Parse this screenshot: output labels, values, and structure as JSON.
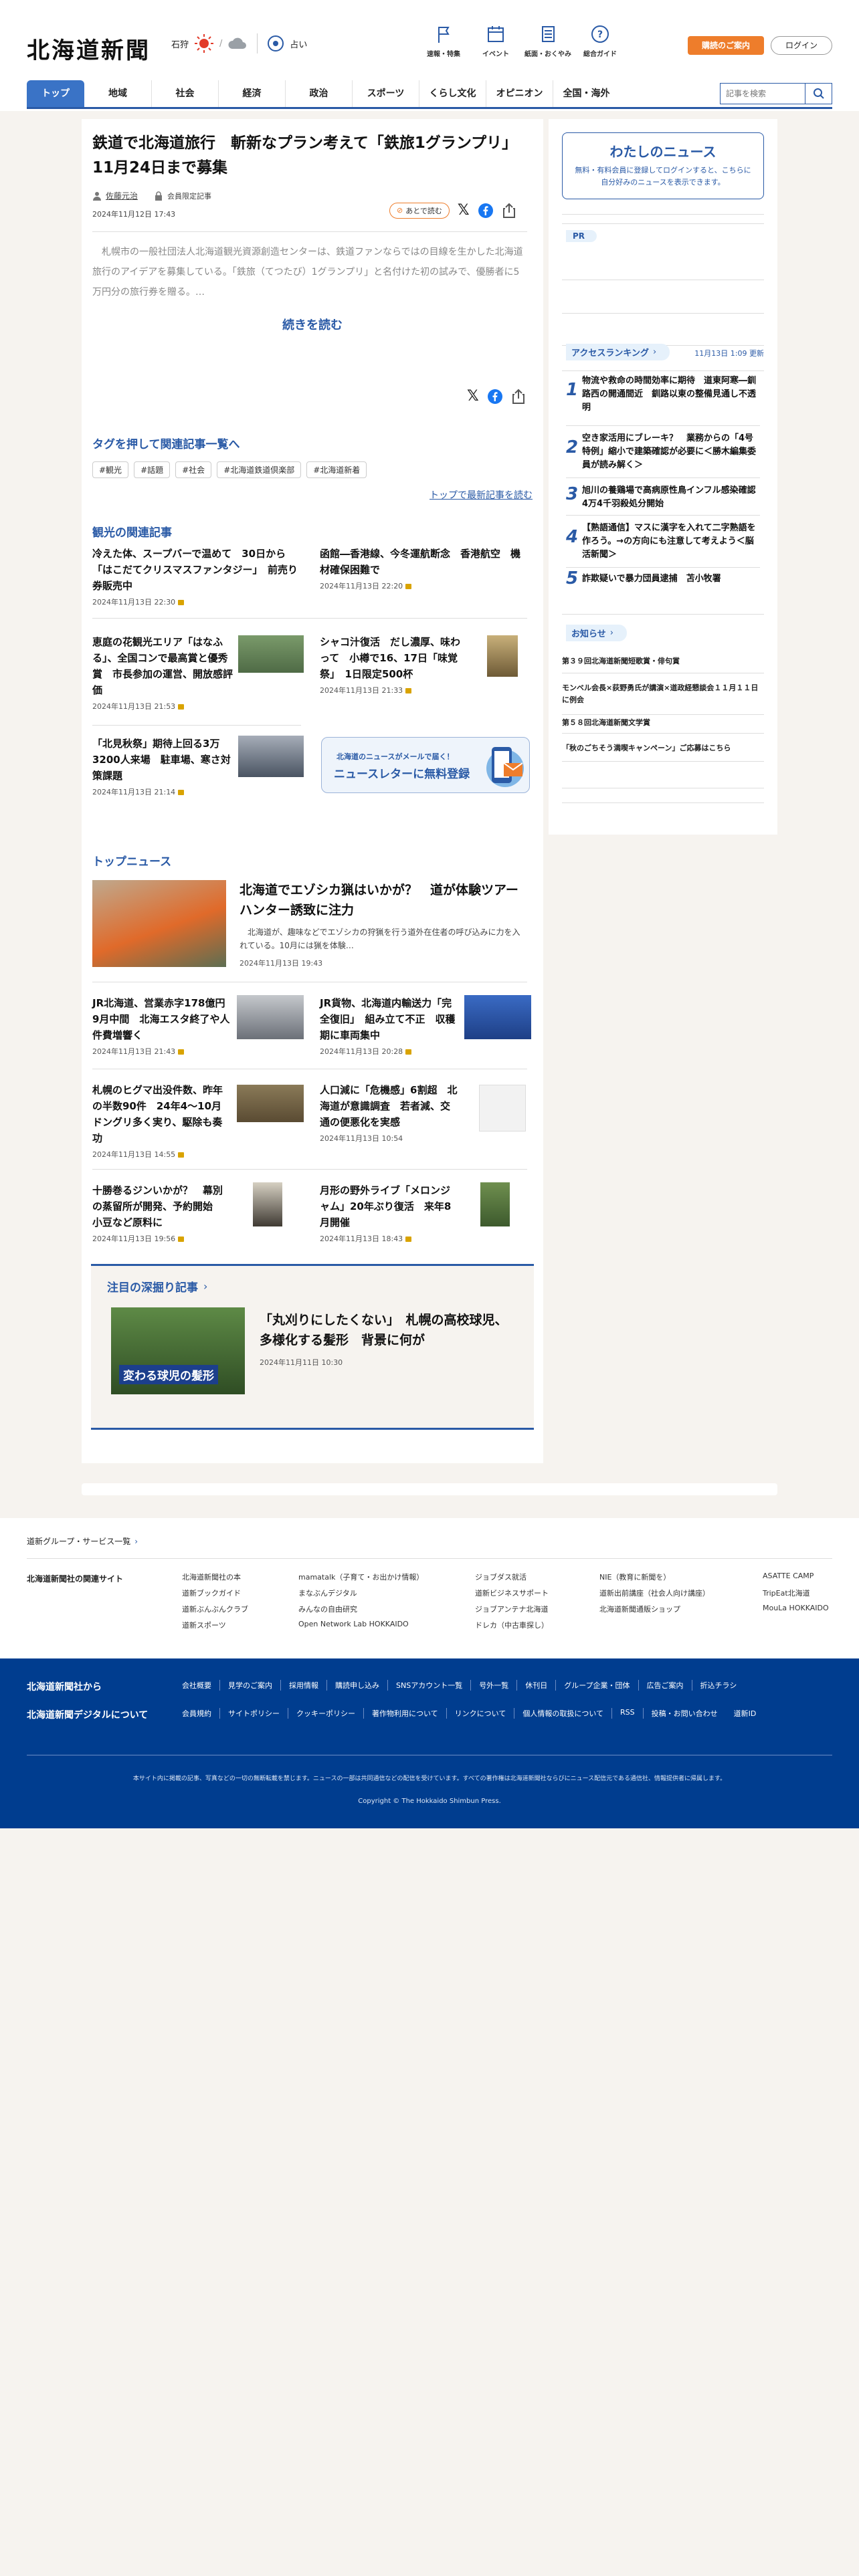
{
  "header": {
    "logo": "北海道新聞",
    "weather_city": "石狩",
    "fortune": "占い",
    "icons": [
      {
        "label": "速報・特集",
        "icon": "flag-icon"
      },
      {
        "label": "イベント",
        "icon": "calendar-icon"
      },
      {
        "label": "紙面・おくやみ",
        "icon": "newspaper-icon"
      },
      {
        "label": "総合ガイド",
        "icon": "question-icon"
      }
    ],
    "subscribe": "購読のご案内",
    "login": "ログイン"
  },
  "nav": {
    "tabs": [
      "トップ",
      "地域",
      "社会",
      "経済",
      "政治",
      "スポーツ",
      "くらし文化",
      "オピニオン",
      "全国・海外"
    ],
    "search_placeholder": "記事を検索"
  },
  "article": {
    "title": "鉄道で北海道旅行　斬新なプラン考えて「鉄旅1グランプリ」11月24日まで募集",
    "author": "佐藤元治",
    "member": "会員限定記事",
    "date": "2024年11月12日 17:43",
    "save_later": "あとで読む",
    "lead": "　札幌市の一般社団法人北海道観光資源創造センターは、鉄道ファンならではの目線を生かした北海道旅行のアイデアを募集している。「鉄旅（てつたび）1グランプリ」と名付けた初の試みで、優勝者に5万円分の旅行券を贈る。…",
    "read_more": "続きを読む"
  },
  "tags": {
    "heading": "タグを押して関連記事一覧へ",
    "items": [
      "#観光",
      "#話題",
      "#社会",
      "#北海道鉄道倶楽部",
      "#北海道新着"
    ],
    "top_link": "トップで最新記事を読む"
  },
  "related": {
    "heading": "観光の関連記事",
    "items": [
      {
        "title": "冷えた体、スープバーで温めて　30日から「はこだてクリスマスファンタジー」　前売り券販売中",
        "date": "2024年11月13日 22:30"
      },
      {
        "title": "函館―香港線、今冬運航断念　香港航空　機材確保困難で",
        "date": "2024年11月13日 22:20"
      },
      {
        "title": "恵庭の花観光エリア「はなふる」、全国コンで最高賞と優秀賞　市長参加の運営、開放感評価",
        "date": "2024年11月13日 21:53"
      },
      {
        "title": "シャコ汁復活　だし濃厚、味わって　小樽で16、17日「味覚祭」　1日限定500杯",
        "date": "2024年11月13日 21:33"
      },
      {
        "title": "「北見秋祭」期待上回る3万3200人来場　駐車場、寒さ対策課題",
        "date": "2024年11月13日 21:14"
      }
    ],
    "banner_small": "北海道のニュースがメールで届く！",
    "banner_big": "ニュースレターに無料登録"
  },
  "topnews": {
    "heading": "トップニュース",
    "main_title": "北海道でエゾシカ猟はいかが？　道が体験ツアー　ハンター誘致に注力",
    "main_lead": "　北海道が、趣味などでエゾシカの狩猟を行う道外在住者の呼び込みに力を入れている。10月には猟を体験…",
    "main_date": "2024年11月13日 19:43",
    "items": [
      {
        "title": "JR北海道、営業赤字178億円　9月中間　北海エスタ終了や人件費増響く",
        "date": "2024年11月13日 21:43"
      },
      {
        "title": "JR貨物、北海道内輸送力「完全復旧」　組み立て不正　収穫期に車両集中",
        "date": "2024年11月13日 20:28"
      },
      {
        "title": "札幌のヒグマ出没件数、昨年の半数90件　24年4～10月　ドングリ多く実り、駆除も奏功",
        "date": "2024年11月13日 14:55"
      },
      {
        "title": "人口減に「危機感」6割超　北海道が意識調査　若者減、交通の便悪化を実感",
        "date": "2024年11月13日 10:54"
      },
      {
        "title": "十勝巻るジンいかが？　幕別の蒸留所が開発、予約開始　小豆など原料に",
        "date": "2024年11月13日 19:56"
      },
      {
        "title": "月形の野外ライブ「メロンジャム」20年ぶり復活　来年8月開催",
        "date": "2024年11月13日 18:43"
      }
    ]
  },
  "feature": {
    "heading": "注目の深掘り記事",
    "thumb_text": "変わる球児の髪形",
    "title": "「丸刈りにしたくない」　札幌の高校球児、多様化する髪形　背景に何が",
    "date": "2024年11月11日 10:30"
  },
  "sidebar": {
    "my_news_title": "わたしのニュース",
    "my_news_text": "無料・有料会員に登録してログインすると、こちらに自分好みのニュースを表示できます。",
    "pr": "PR",
    "ranking_heading": "アクセスランキング",
    "ranking_updated": "11月13日 1:09 更新",
    "ranking": [
      "物流や救命の時間効率に期待　道東阿寒―釧路西の開通間近　釧路以東の整備見通し不透明",
      "空き家活用にブレーキ？　業務からの「4号特例」縮小で建築確認が必要に＜勝木編集委員が読み解く＞",
      "旭川の養鶏場で高病原性鳥インフル感染確認　4万4千羽殺処分開始",
      "【熟語通信】マスに漢字を入れて二字熟語を作ろう。→の方向にも注意して考えよう＜脳活新聞＞",
      "詐欺疑いで暴力団員逮捕　苫小牧署"
    ],
    "notice_heading": "お知らせ",
    "notices": [
      "第３９回北海道新聞短歌賞・俳句賞",
      "モンベル会長×荻野勇氏が講演×道政経懇談会１１月１１日に例会",
      "第５８回北海道新聞文学賞",
      "「秋のごちそう満喫キャンペーン」ご応募はこちら"
    ]
  },
  "footer": {
    "group_link": "道新グループ・サービス一覧",
    "related_label": "北海道新聞社の関連サイト",
    "related_sites": [
      [
        "北海道新聞社の本",
        "道新ブックガイド",
        "道新ぶんぶんクラブ",
        "道新スポーツ"
      ],
      [
        "mamatalk（子育て・お出かけ情報）",
        "まなぶんデジタル",
        "みんなの自由研究",
        "Open Network Lab HOKKAIDO"
      ],
      [
        "ジョブダス就活",
        "道新ビジネスサポート",
        "ジョブアンテナ北海道",
        "ドレカ（中古車探し）"
      ],
      [
        "NIE（教育に新聞を）",
        "道新出前講座（社会人向け講座）",
        "北海道新聞通販ショップ"
      ],
      [
        "ASATTE CAMP",
        "TripEat北海道",
        "MouLa HOKKAIDO"
      ]
    ],
    "from_company": "北海道新聞社から",
    "about_digital": "北海道新聞デジタルについて",
    "company_links": [
      "会社概要",
      "見学のご案内",
      "採用情報",
      "購読申し込み",
      "SNSアカウント一覧",
      "号外一覧",
      "休刊日",
      "グループ企業・団体",
      "広告ご案内",
      "折込チラシ"
    ],
    "digital_links": [
      "会員規約",
      "サイトポリシー",
      "クッキーポリシー",
      "著作物利用について",
      "リンクについて",
      "個人情報の取扱について",
      "RSS",
      "投稿・お問い合わせ",
      "道新ID"
    ],
    "notice": "本サイト内に掲載の記事、写真などの一切の無断転載を禁じます。ニュースの一部は共同通信などの配信を受けています。すべての著作権は北海道新聞社ならびにニュース配信元である通信社、情報提供者に帰属します。",
    "copyright": "Copyright © The Hokkaido Shimbun Press."
  },
  "colors": {
    "brand": "#2a5aa6",
    "accent": "#ee7d2b",
    "footer": "#003d8f"
  }
}
